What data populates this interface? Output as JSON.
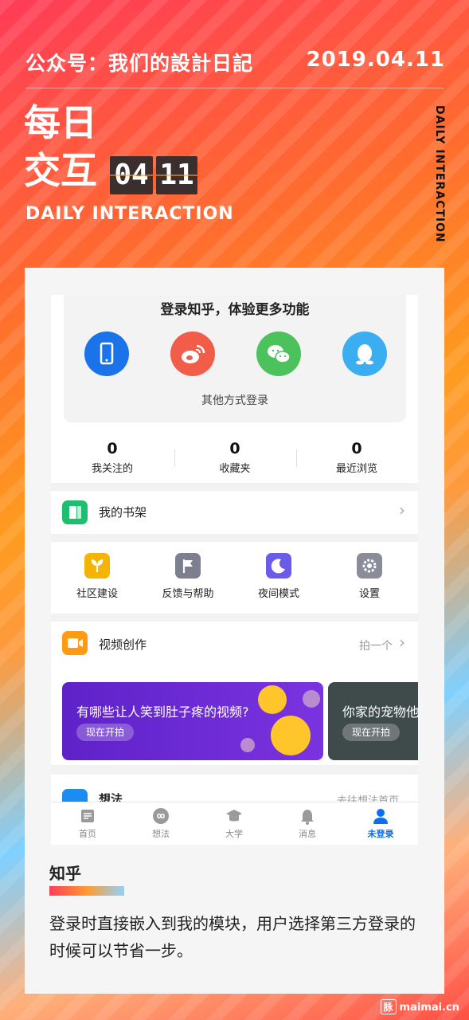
{
  "poster": {
    "account": "公众号：我们的設計日記",
    "date": "2019.04.11",
    "title_line1": "每日",
    "title_line2": "交互",
    "flip_month": "04",
    "flip_day": "11",
    "subtitle": "DAILY INTERACTION",
    "vertical_label": "DAILY INTERACTION"
  },
  "login": {
    "title": "登录知乎，体验更多功能",
    "methods": [
      {
        "name": "phone",
        "icon": "phone-icon",
        "color": "#1a73e8"
      },
      {
        "name": "weibo",
        "icon": "weibo-icon",
        "color": "#f25d4a"
      },
      {
        "name": "wechat",
        "icon": "wechat-icon",
        "color": "#4cc25c"
      },
      {
        "name": "qq",
        "icon": "qq-icon",
        "color": "#3aaef0"
      }
    ],
    "other": "其他方式登录"
  },
  "stats": [
    {
      "value": "0",
      "label": "我关注的"
    },
    {
      "value": "0",
      "label": "收藏夹"
    },
    {
      "value": "0",
      "label": "最近浏览"
    }
  ],
  "bookshelf": {
    "label": "我的书架",
    "icon": "book-icon"
  },
  "tools": [
    {
      "label": "社区建设",
      "icon": "sprout-icon",
      "color": "#f5b400"
    },
    {
      "label": "反馈与帮助",
      "icon": "flag-icon",
      "color": "#7b7f8e"
    },
    {
      "label": "夜间模式",
      "icon": "moon-icon",
      "color": "#6a5be8"
    },
    {
      "label": "设置",
      "icon": "gear-icon",
      "color": "#8a8d99"
    }
  ],
  "video": {
    "label": "视频创作",
    "action": "拍一个",
    "banners": [
      {
        "text": "有哪些让人笑到肚子疼的视频?",
        "button": "现在开拍"
      },
      {
        "text": "你家的宠物他",
        "button": "现在开拍"
      }
    ]
  },
  "idea": {
    "label": "想法",
    "action": "去往想法首页"
  },
  "tabs": [
    {
      "label": "首页",
      "icon": "home-icon"
    },
    {
      "label": "想法",
      "icon": "infinity-icon"
    },
    {
      "label": "大学",
      "icon": "graduation-cap-icon"
    },
    {
      "label": "消息",
      "icon": "bell-icon"
    },
    {
      "label": "未登录",
      "icon": "user-icon",
      "active": true
    }
  ],
  "caption": {
    "app_name": "知乎",
    "description": "登录时直接嵌入到我的模块，用户选择第三方登录的时候可以节省一步。"
  },
  "watermark": {
    "box": "脉",
    "text": "maimai.cn"
  },
  "colors": {
    "active_tab": "#0b70f0",
    "banner_purple": "#6a2bd6",
    "accent_orange": "#ff9a12"
  }
}
